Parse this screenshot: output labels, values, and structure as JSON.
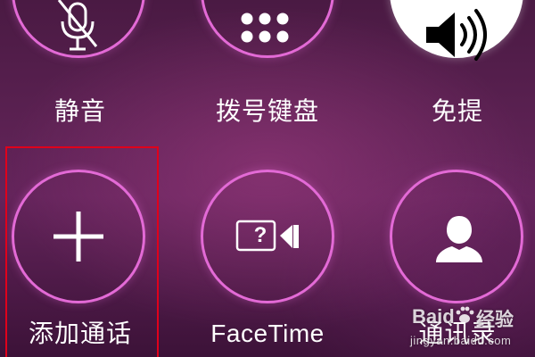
{
  "buttons": {
    "mute": {
      "label": "静音",
      "icon": "microphone-muted-icon"
    },
    "keypad": {
      "label": "拨号键盘",
      "icon": "keypad-grid-icon"
    },
    "speaker": {
      "label": "免提",
      "icon": "speaker-icon",
      "active": true
    },
    "add_call": {
      "label": "添加通话",
      "icon": "plus-icon"
    },
    "facetime": {
      "label": "FaceTime",
      "icon": "facetime-unavailable-icon"
    },
    "contacts": {
      "label": "通讯录",
      "icon": "person-silhouette-icon"
    }
  },
  "icons": {
    "facetime_glyph": "?"
  },
  "watermark": {
    "brand": "Baid",
    "brand_cn": "经验",
    "url": "jingyan.baidu.com"
  },
  "colors": {
    "ring": "#e36ad6",
    "highlight": "#e0001b",
    "background": "#5b2152",
    "text": "#ffffff"
  }
}
